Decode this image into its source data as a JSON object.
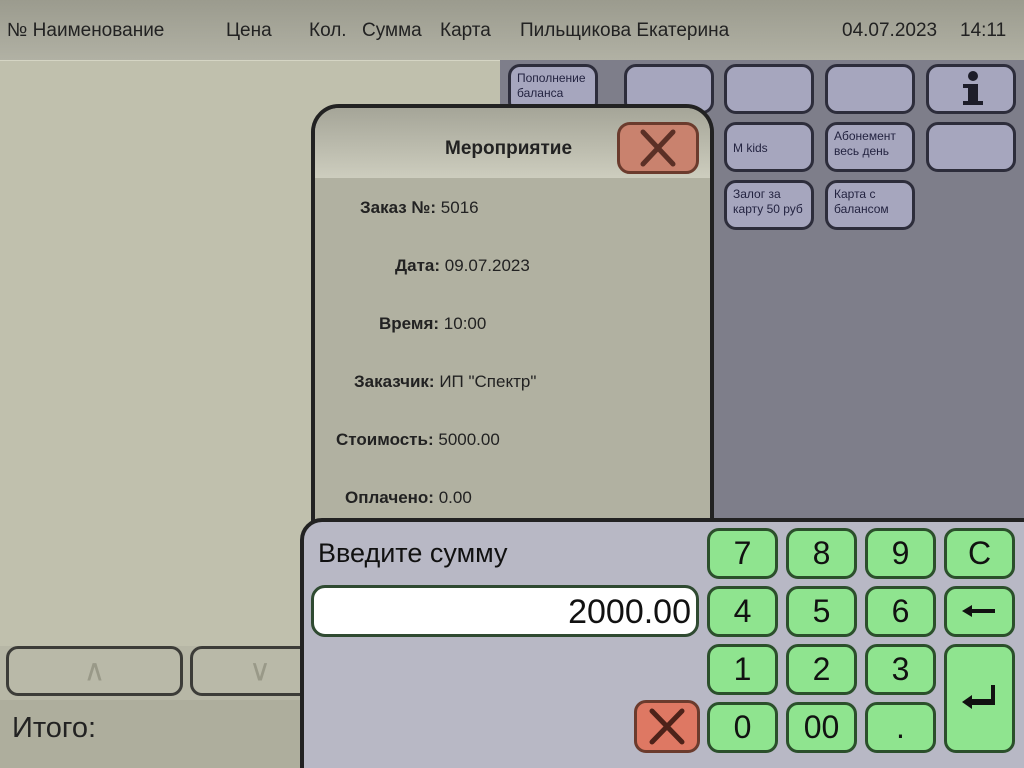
{
  "header": {
    "col_number_name": "№ Наименование",
    "col_price": "Цена",
    "col_qty": "Кол.",
    "col_sum": "Сумма",
    "col_card": "Карта",
    "cashier": "Пильщикова Екатерина",
    "date": "04.07.2023",
    "time": "14:11"
  },
  "footer": {
    "total_label": "Итого:"
  },
  "nav": {
    "up_arrow": "∧",
    "down_arrow": "∨"
  },
  "products": {
    "balance_topup": "Пополнение баланса",
    "mkids": "M kids",
    "subscription_day": "Абонемент весь день",
    "card_deposit": "Залог за карту 50 руб",
    "card_with_balance": "Карта с балансом",
    "info_icon": "info-icon"
  },
  "event_dialog": {
    "title": "Мероприятие",
    "order_label": "Заказ №:",
    "order_value": "5016",
    "date_label": "Дата:",
    "date_value": "09.07.2023",
    "time_label": "Время:",
    "time_value": "10:00",
    "customer_label": "Заказчик:",
    "customer_value": "ИП \"Спектр\"",
    "cost_label": "Стоимость:",
    "cost_value": "5000.00",
    "paid_label": "Оплачено:",
    "paid_value": "0.00"
  },
  "amount_dialog": {
    "prompt": "Введите сумму",
    "value": "2000.00",
    "keys": {
      "k7": "7",
      "k8": "8",
      "k9": "9",
      "clear": "C",
      "k4": "4",
      "k5": "5",
      "k6": "6",
      "k1": "1",
      "k2": "2",
      "k3": "3",
      "k0": "0",
      "k00": "00",
      "dot": "."
    }
  },
  "colors": {
    "key_green": "#8fe48f",
    "cancel_red": "#de7863",
    "product_lavender": "#a6a6be",
    "background_olive": "#b7b7a6"
  }
}
